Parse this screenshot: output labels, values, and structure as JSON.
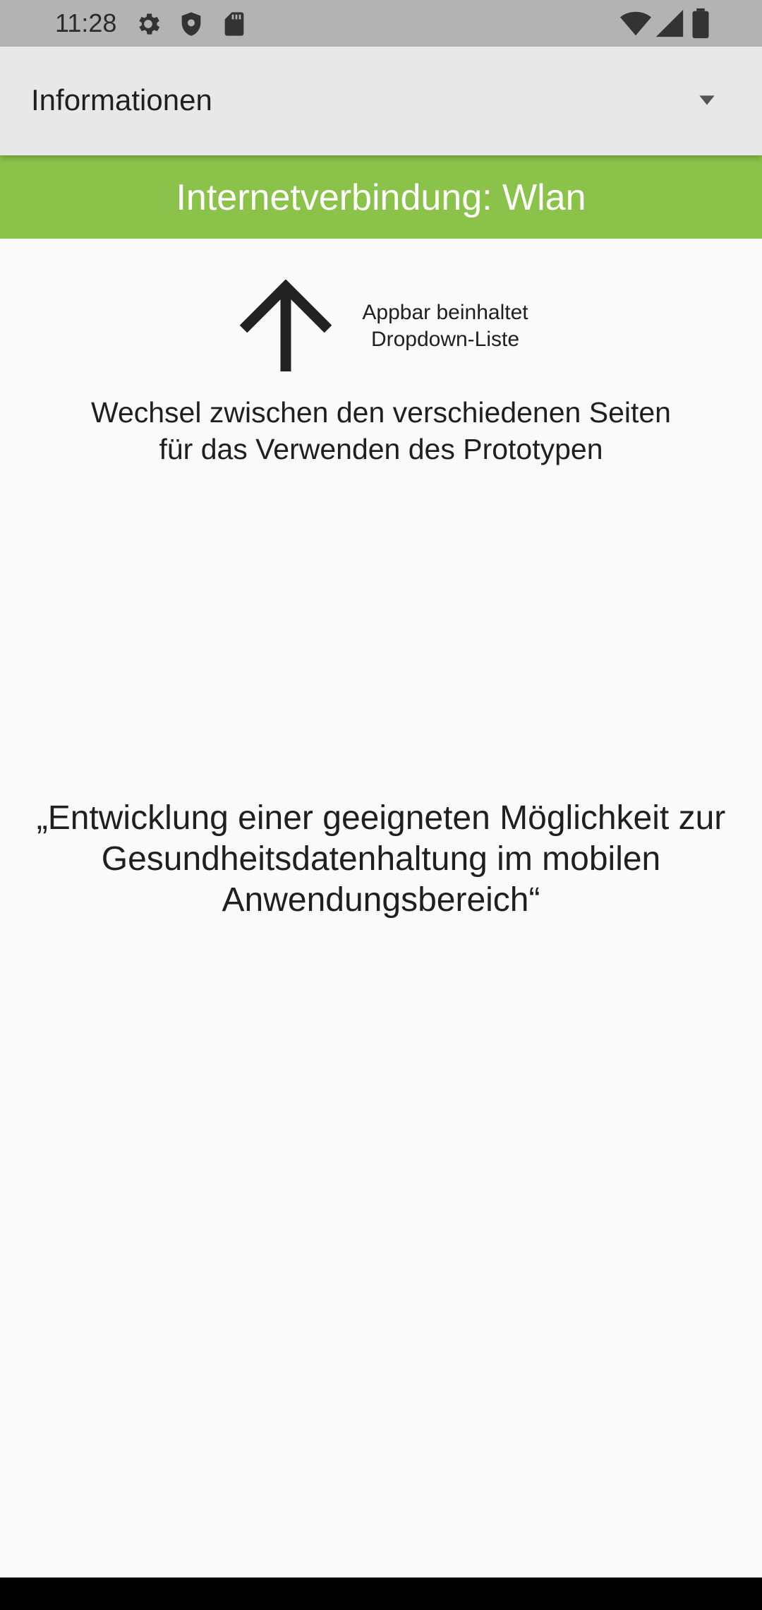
{
  "status_bar": {
    "time": "11:28",
    "left_icons": [
      "gear-icon",
      "shield-icon",
      "sd-card-icon"
    ],
    "right_icons": [
      "wifi-icon",
      "cell-signal-icon",
      "battery-icon"
    ]
  },
  "appbar": {
    "dropdown": {
      "selected": "Informationen",
      "icon": "arrow-drop-down-icon"
    }
  },
  "banner": {
    "text": "Internetverbindung: Wlan",
    "color": "#8bc34a"
  },
  "hint": {
    "icon": "arrow-up-icon",
    "line1": "Appbar beinhaltet",
    "line2": "Dropdown-Liste"
  },
  "description": {
    "line1": "Wechsel zwischen den verschiedenen Seiten",
    "line2": "für das Verwenden des Prototypen"
  },
  "project_title": {
    "line1": "„Entwicklung einer geeigneten Möglichkeit zur",
    "line2": "Gesundheitsdatenhaltung im mobilen",
    "line3": "Anwendungsbereich“"
  }
}
